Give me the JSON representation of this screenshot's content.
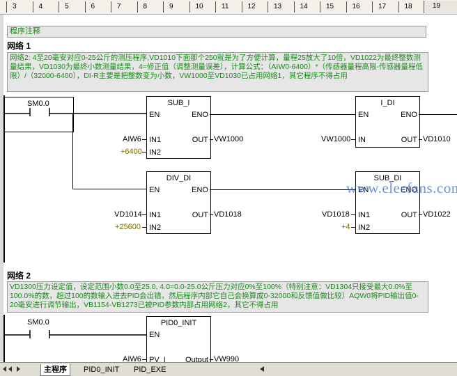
{
  "ruler": {
    "ticks": [
      "3",
      "4",
      "5",
      "6",
      "7",
      "8",
      "9",
      "10",
      "11",
      "12",
      "13",
      "14",
      "15",
      "16",
      "17",
      "18"
    ],
    "last": "19"
  },
  "program_comment": {
    "label": "程序注释"
  },
  "network1": {
    "label": "网络 1",
    "comment": "网络2: 4至20毫安对应0-25公斤的测压程序,VD1010下面那个250就是为了方便计算，量程25放大了10倍，VD1022为最终整数测量结果，VD1030为最终小数测量结果，4=修正值（调整测量误差），计算公式：（AIW0-6400）*（传感器量程高限-传感器量程低限）/（32000-6400），DI-R主要是把整数变为小数，VW1000至VD1030已占用网络1，其它程序不得占用",
    "contact": "SM0.0",
    "blocks": [
      {
        "title": "SUB_I",
        "en": "EN",
        "eno": "ENO",
        "in1_pin": "IN1",
        "in2_pin": "IN2",
        "out_pin": "OUT",
        "in1": "AIW6",
        "in2": "+6400",
        "out": "VW1000"
      },
      {
        "title": "I_DI",
        "en": "EN",
        "eno": "ENO",
        "in_pin": "IN",
        "out_pin": "OUT",
        "in": "VW1000",
        "out": "VD1010"
      },
      {
        "title": "DIV_DI",
        "en": "EN",
        "eno": "ENO",
        "in1_pin": "IN1",
        "in2_pin": "IN2",
        "out_pin": "OUT",
        "in1": "VD1014",
        "in2": "+25600",
        "out": "VD1018"
      },
      {
        "title": "SUB_DI",
        "en": "EN",
        "eno": "ENO",
        "in1_pin": "IN1",
        "in2_pin": "IN2",
        "out_pin": "OUT",
        "in1": "VD1018",
        "in2": "+4",
        "out": "VD1022"
      }
    ]
  },
  "network2": {
    "label": "网络 2",
    "comment": "VD1300压力设定值，设定范围小数0.0至25.0,  4.0=0.0-25.0公斤压力对应0%至100%（特别注意：VD1304只接受最大0.0%至100.0%的数，超过100的数输入进去PID会出错，然后程序内部它自己会换算成0-32000和反馈值做比较）AQW0将PID输出值0-20毫安进行调节输出，VB1154-VB1273已被PID参数内部占用网络2，其它不得占用",
    "contact": "SM0.0",
    "block": {
      "title": "PID0_INIT",
      "en": "EN",
      "pv_pin": "PV_I",
      "out_pin": "Output",
      "pv": "AIW6",
      "out": "VW990"
    }
  },
  "watermark": "www.elecfans.com",
  "tabs": [
    "主程序",
    "PID0_INIT",
    "PID_EXE"
  ]
}
